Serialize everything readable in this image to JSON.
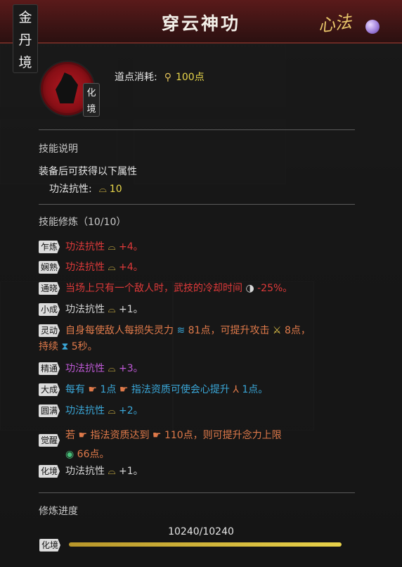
{
  "header": {
    "title": "穿云神功",
    "realm_chars": [
      "金",
      "丹",
      "境"
    ],
    "mode_label": "心法"
  },
  "skill": {
    "emblem_tag_chars": [
      "化",
      "境"
    ],
    "cost_label": "道点消耗:",
    "cost_value": "100点"
  },
  "description": {
    "section_title": "技能说明",
    "intro": "装备后可获得以下属性",
    "attr_label": "功法抗性:",
    "attr_value": "10"
  },
  "cultivation": {
    "section_title": "技能修炼（10/10）",
    "rows": [
      {
        "badge": "乍炼",
        "text": "功法抗性",
        "value": "+4。"
      },
      {
        "badge": "娴熟",
        "text": "功法抗性",
        "value": "+4。"
      },
      {
        "badge": "通晓",
        "text": "当场上只有一个敌人时，武技的冷却时间",
        "value": "-25%。"
      },
      {
        "badge": "小成",
        "text": "功法抗性",
        "value": "+1。"
      },
      {
        "badge": "灵动",
        "text1": "自身每使敌人每损失灵力",
        "v1": "81点，可提升攻击",
        "v2": "8点，",
        "text2": "持续",
        "v3": "5秒。"
      },
      {
        "badge": "精通",
        "text": "功法抗性",
        "value": "+3。"
      },
      {
        "badge": "大成",
        "t1": "每有",
        "v1": "1点",
        "t2": "指法资质可使会心提升",
        "v2": "1点。"
      },
      {
        "badge": "圆满",
        "text": "功法抗性",
        "value": "+2。"
      },
      {
        "badge": "觉醒",
        "t1": "若",
        "t2": "指法资质达到",
        "v1": "110点，则可提升念力上限",
        "v2": "66点。"
      },
      {
        "badge": "化境",
        "text": "功法抗性",
        "value": "+1。"
      }
    ]
  },
  "progress": {
    "label": "修炼进度",
    "value_text": "10240/10240",
    "tag": "化境",
    "fraction": 1.0
  }
}
